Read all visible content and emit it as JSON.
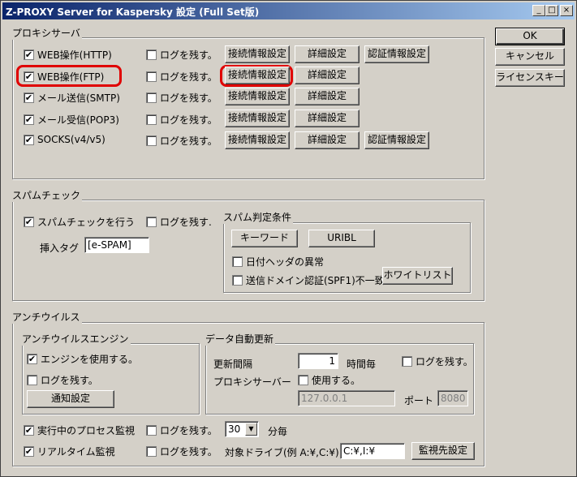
{
  "window": {
    "title": "Z-PROXY Server for Kaspersky 設定 (Full Set版)"
  },
  "side_buttons": {
    "ok": "OK",
    "cancel": "キャンセル",
    "license": "ライセンスキー"
  },
  "proxy": {
    "label": "プロキシサーバ",
    "rows": [
      {
        "name": "WEB操作(HTTP)",
        "checked": true,
        "log": "ログを残す。",
        "conn": "接続情報設定",
        "detail": "詳細設定",
        "auth": "認証情報設定"
      },
      {
        "name": "WEB操作(FTP)",
        "checked": true,
        "log": "ログを残す。",
        "conn": "接続情報設定",
        "detail": "詳細設定"
      },
      {
        "name": "メール送信(SMTP)",
        "checked": true,
        "log": "ログを残す。",
        "conn": "接続情報設定",
        "detail": "詳細設定"
      },
      {
        "name": "メール受信(POP3)",
        "checked": true,
        "log": "ログを残す。",
        "conn": "接続情報設定",
        "detail": "詳細設定"
      },
      {
        "name": "SOCKS(v4/v5)",
        "checked": true,
        "log": "ログを残す。",
        "conn": "接続情報設定",
        "detail": "詳細設定",
        "auth": "認証情報設定"
      }
    ]
  },
  "spam": {
    "label": "スパムチェック",
    "enable": "スパムチェックを行う",
    "log": "ログを残す.",
    "tag_label": "挿入タグ",
    "tag_value": "[e-SPAM]",
    "cond_label": "スパム判定条件",
    "keyword": "キーワード",
    "uribl": "URIBL",
    "date_header": "日付ヘッダの異常",
    "spf": "送信ドメイン認証(SPF1)不一致",
    "whitelist": "ホワイトリスト"
  },
  "antivirus": {
    "label": "アンチウイルス",
    "engine_label": "アンチウイルスエンジン",
    "use_engine": "エンジンを使用する。",
    "log": "ログを残す。",
    "notify": "通知設定",
    "update_label": "データ自動更新",
    "interval_label": "更新間隔",
    "interval_value": "1",
    "interval_unit": "時間毎",
    "update_log": "ログを残す。",
    "proxy_label": "プロキシサーバー",
    "proxy_use": "使用する。",
    "proxy_host": "127.0.0.1",
    "port_label": "ポート",
    "port_value": "8080",
    "process_monitor": "実行中のプロセス監視",
    "process_log": "ログを残す。",
    "minutes_value": "30",
    "minutes_unit": "分毎",
    "realtime": "リアルタイム監視",
    "realtime_log": "ログを残す。",
    "drive_label": "対象ドライブ(例 A:¥,C:¥)",
    "drive_value": "C:¥,I:¥",
    "monitor_btn": "監視先設定"
  }
}
